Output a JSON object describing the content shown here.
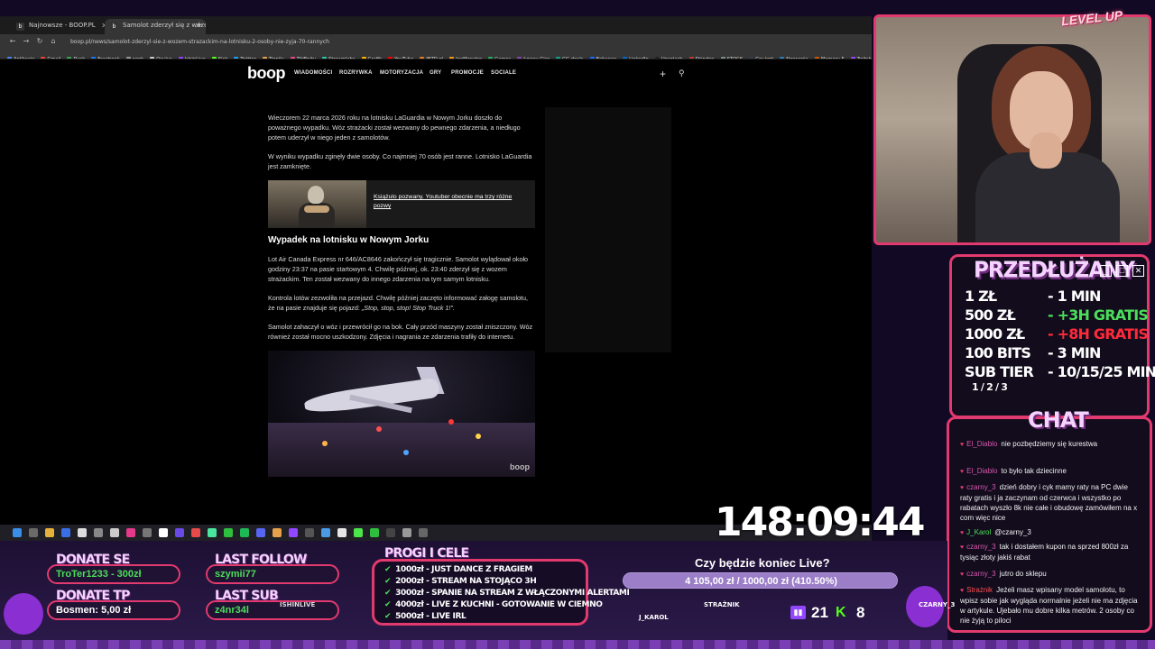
{
  "browser": {
    "tabs": [
      {
        "label": "Najnowsze - BOOP.PL",
        "favicon": "b",
        "active": false
      },
      {
        "label": "Samolot zderzył się z wozem strażackim",
        "favicon": "b",
        "active": true
      }
    ],
    "url": "boop.pl/news/samolot-zderzyl-sie-z-wozem-strazackim-na-lotnisku-2-osoby-nie-zyja-70-rannych",
    "bookmarks": [
      "Aplikacje",
      "Gmail",
      "Dysk",
      "Facebook",
      "work",
      "Oculus",
      "IshinLive",
      "Kick",
      "Twitter",
      "Tippily",
      "TikFinity",
      "Streamlabs",
      "Grafik",
      "YouTube",
      "IBZD.pl",
      "JoeMonster",
      "Games",
      "Łowcy Gier",
      "GG.deals",
      "Behance",
      "LinkedIn",
      "Unsplash",
      "Shinden",
      "STOCK",
      "Gry tmt",
      "Norwegia",
      "Memory 5",
      "Twitch"
    ]
  },
  "site": {
    "logo": "boop",
    "nav": [
      "WIADOMOŚCI",
      "ROZRYWKA",
      "MOTORYZACJA",
      "GRY",
      "PROMOCJE",
      "SOCIALE"
    ]
  },
  "article": {
    "p1": "Wieczorem 22 marca 2026 roku na lotnisku LaGuardia w Nowym Jorku doszło do poważnego wypadku. Wóz strażacki został wezwany do pewnego zdarzenia, a niedługo potem uderzył w niego jeden z samolotów.",
    "p2": "W wyniku wypadku zginęły dwie osoby. Co najmniej 70 osób jest ranne. Lotnisko LaGuardia jest zamknięte.",
    "related_title": "Książulo pozwany. Youtuber obecnie ma trzy różne pozwy",
    "section_heading": "Wypadek na lotnisku w Nowym Jorku",
    "p3": "Lot Air Canada Express nr 646/AC8646 zakończył się tragicznie. Samolot wylądował około godziny 23:37 na pasie startowym 4. Chwilę później, ok. 23:40 zderzył się z wozem strażackim. Ten został wezwany do innego zdarzenia na tym samym lotnisku.",
    "p4_start": "Kontrola lotów zezwoliła na przejazd. Chwilę później zaczęto informować załogę samolotu, że na pasie znajduje się pojazd: ",
    "p4_quote": "„Stop, stop, stop! Stop Truck 1!”.",
    "p5": "Samolot zahaczył o wóz i przewrócił go na bok. Cały przód maszyny został zniszczony. Wóz również został mocno uszkodzony. Zdjęcia i nagrania ze zdarzenia trafiły do internetu.",
    "hero_watermark": "boop"
  },
  "overlay": {
    "cam_logo": "LEVEL UP",
    "prz_title": "PRZEDŁUŻANY",
    "prz_rows": [
      {
        "amount": "1 ZŁ",
        "value": "- 1 MIN",
        "color": "#ffffff"
      },
      {
        "amount": "500 ZŁ",
        "value": "- +3H GRATIS",
        "color": "#4bde5a"
      },
      {
        "amount": "1000 ZŁ",
        "value": "- +8H GRATIS",
        "color": "#ff2a3a"
      },
      {
        "amount": "100 BITS",
        "value": "- 3 MIN",
        "color": "#ffffff"
      },
      {
        "amount": "SUB TIER",
        "value": "- 10/15/25 MIN",
        "color": "#ffffff"
      }
    ],
    "prz_tier_sub": "1 / 2 / 3",
    "chat_title": "CHAT",
    "chat": [
      {
        "user": "El_Diablo",
        "text": "nie pozbędziemy się kurestwa"
      },
      {
        "user": "El_Diablo",
        "text": "to było tak dziecinne"
      },
      {
        "user": "czarny_3",
        "text": "dzień dobry i cyk mamy raty na PC dwie raty gratis i ja zaczynam od czerwca i wszystko po rabatach wyszło 8k nie całe i obudowę zamówiłem na x com więc nice"
      },
      {
        "user": "J_Karol",
        "text": "@czarny_3"
      },
      {
        "user": "czarny_3",
        "text": "tak i dostałem kupon na sprzed 800zł za tysiąc złoty jakiś rabat"
      },
      {
        "user": "czarny_3",
        "text": "jutro do sklepu"
      },
      {
        "user": "Strażnik",
        "text": "Jeżeli masz wpisany model samolotu, to wpisz sobie jak wygląda normalnie jeżeli nie ma zdjęcia w artykule. Ujebało mu dobre kilka metrów. 2 osoby co nie żyją to piloci"
      }
    ],
    "timer": "148:09:44",
    "donate_se_label": "DONATE SE",
    "donate_se_val": "TroTer1233 - 300zł",
    "donate_tp_label": "DONATE TP",
    "donate_tp_val": "Bosmen: 5,00 zł",
    "last_follow_label": "LAST FOLLOW",
    "last_follow_val": "szymii77",
    "last_sub_label": "LAST SUB",
    "last_sub_val": "z4nr34l",
    "ishin_tag": "ISHINLIVE",
    "progi_title": "PROGI I CELE",
    "goals": [
      "1000zł - JUST DANCE Z FRAGIEM",
      "2000zł - STREAM NA STOJĄCO 3H",
      "3000zł - SPANIE NA STREAM Z WŁĄCZONYMI ALERTAMI",
      "4000zł - LIVE Z KUCHNI - GOTOWANIE W CIEMNO",
      "5000zł - LIVE IRL"
    ],
    "question": "Czy będzie koniec Live?",
    "progress_text": "4 105,00 zł / 1000,00 zł (410.50%)",
    "progress_fraction": 1.0,
    "viewers": [
      "J_KAROL",
      "STRAŻNIK",
      "CZARNY_3"
    ],
    "twitch_viewers": "21",
    "kick_viewers": "8",
    "colors": {
      "accent": "#e23a6e",
      "purple": "#9146ff",
      "kick": "#53fc18"
    }
  }
}
